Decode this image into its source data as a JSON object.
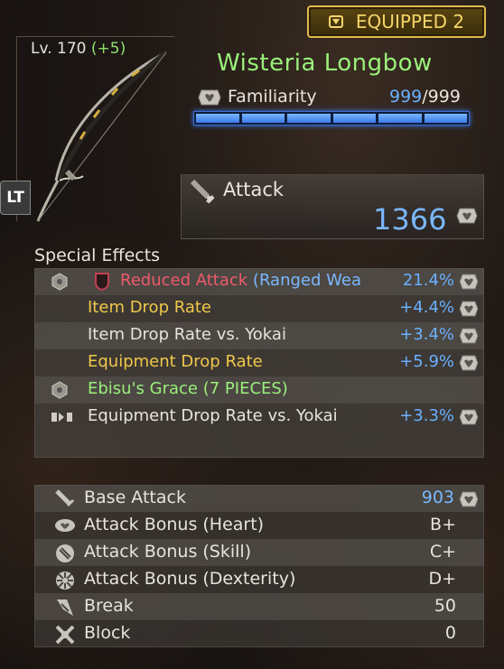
{
  "equipped": {
    "label": "EQUIPPED 2"
  },
  "weapon": {
    "level": "Lv. 170",
    "level_bonus": "(+5)",
    "name": "Wisteria Longbow"
  },
  "controller": {
    "lt": "LT"
  },
  "familiarity": {
    "label": "Familiarity",
    "current": "999",
    "max": "/999",
    "segments": 6
  },
  "attack": {
    "label": "Attack",
    "value": "1366"
  },
  "special_effects": {
    "title": "Special Effects",
    "rows": [
      {
        "name": "Reduced Attack",
        "qualifier": "(Ranged Wea",
        "value": "21.4%",
        "color": "#ef5a6a"
      },
      {
        "name": "Item Drop Rate",
        "value": "+4.4%",
        "color": "#f0c84a"
      },
      {
        "name": "Item Drop Rate vs. Yokai",
        "value": "+3.4%",
        "color": "#e8e4dc"
      },
      {
        "name": "Equipment Drop Rate",
        "value": "+5.9%",
        "color": "#f0c84a"
      },
      {
        "name": "Ebisu's Grace (7 PIECES)",
        "value": "",
        "color": "#9af07a"
      },
      {
        "name": "Equipment Drop Rate vs. Yokai",
        "value": "+3.3%",
        "color": "#e8e4dc"
      }
    ]
  },
  "stats": [
    {
      "name": "Base Attack",
      "value": "903",
      "icon": "sword-icon"
    },
    {
      "name": "Attack Bonus (Heart)",
      "value": "B+",
      "icon": "heart-icon"
    },
    {
      "name": "Attack Bonus (Skill)",
      "value": "C+",
      "icon": "skill-icon"
    },
    {
      "name": "Attack Bonus (Dexterity)",
      "value": "D+",
      "icon": "dexterity-icon"
    },
    {
      "name": "Break",
      "value": "50",
      "icon": "break-icon"
    },
    {
      "name": "Block",
      "value": "0",
      "icon": "block-icon"
    }
  ]
}
